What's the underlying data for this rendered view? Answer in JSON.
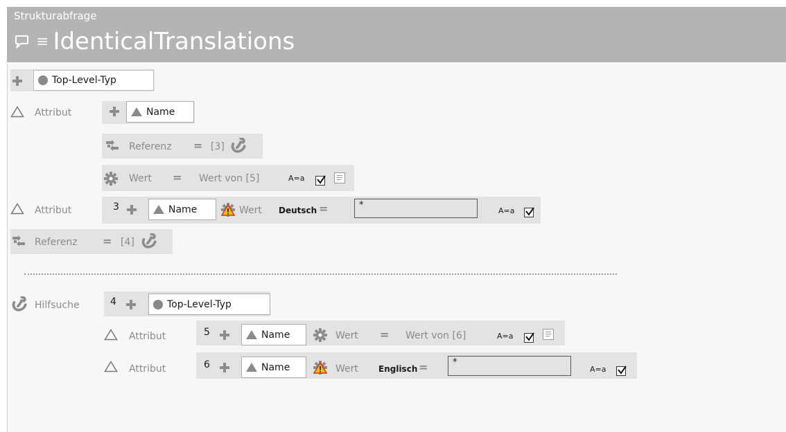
{
  "header": {
    "subtitle": "Strukturabfrage",
    "title": "IdenticalTranslations",
    "menu_glyph": "≡",
    "icons": [
      "query-icon",
      "menu-icon"
    ]
  },
  "rows": {
    "root_type": "Top-Level-Typ",
    "attr1": {
      "label": "Attribut",
      "name": "Name"
    },
    "ref1": {
      "label": "Referenz",
      "eq": "=",
      "target": "[3]"
    },
    "wert1": {
      "label": "Wert",
      "eq": "=",
      "source": "Wert von [5]",
      "case": "A=a"
    },
    "attr2": {
      "label": "Attribut",
      "num": "3",
      "name": "Name",
      "wert": "Wert",
      "lang": "Deutsch",
      "eq": "=",
      "value": "*",
      "case": "A=a"
    },
    "ref2": {
      "label": "Referenz",
      "eq": "=",
      "target": "[4]"
    },
    "hilf": {
      "label": "Hilfsuche",
      "num": "4",
      "type": "Top-Level-Typ"
    },
    "attr3": {
      "label": "Attribut",
      "num": "5",
      "name": "Name",
      "wert": "Wert",
      "eq": "=",
      "source": "Wert von [6]",
      "case": "A=a"
    },
    "attr4": {
      "label": "Attribut",
      "num": "6",
      "name": "Name",
      "wert": "Wert",
      "lang": "Englisch",
      "eq": "=",
      "value": "*",
      "case": "A=a"
    }
  },
  "colors": {
    "header_bg": "#b4b4b4",
    "strip_bg": "#e3e3e3",
    "icon_grey": "#8a8a8a",
    "warn_yellow": "#f2c200",
    "warn_red": "#d32f2f"
  }
}
